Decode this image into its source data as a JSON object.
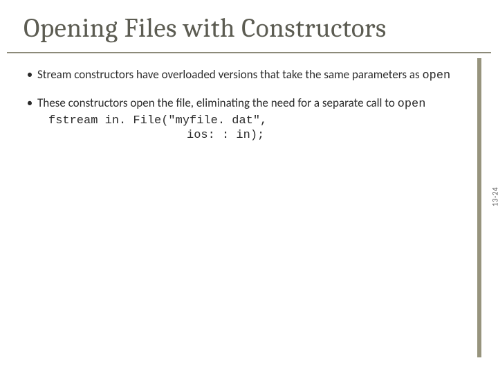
{
  "title": "Opening Files with Constructors",
  "bullets": [
    {
      "pre": "Stream constructors have overloaded versions that take the same parameters as ",
      "kw": "open"
    },
    {
      "pre": "These constructors open the file, eliminating the need for a separate call to ",
      "kw": "open"
    }
  ],
  "code": {
    "line1": "fstream in. File(\"myfile. dat\",",
    "line2": "ios: : in);"
  },
  "page_number": "13-24"
}
